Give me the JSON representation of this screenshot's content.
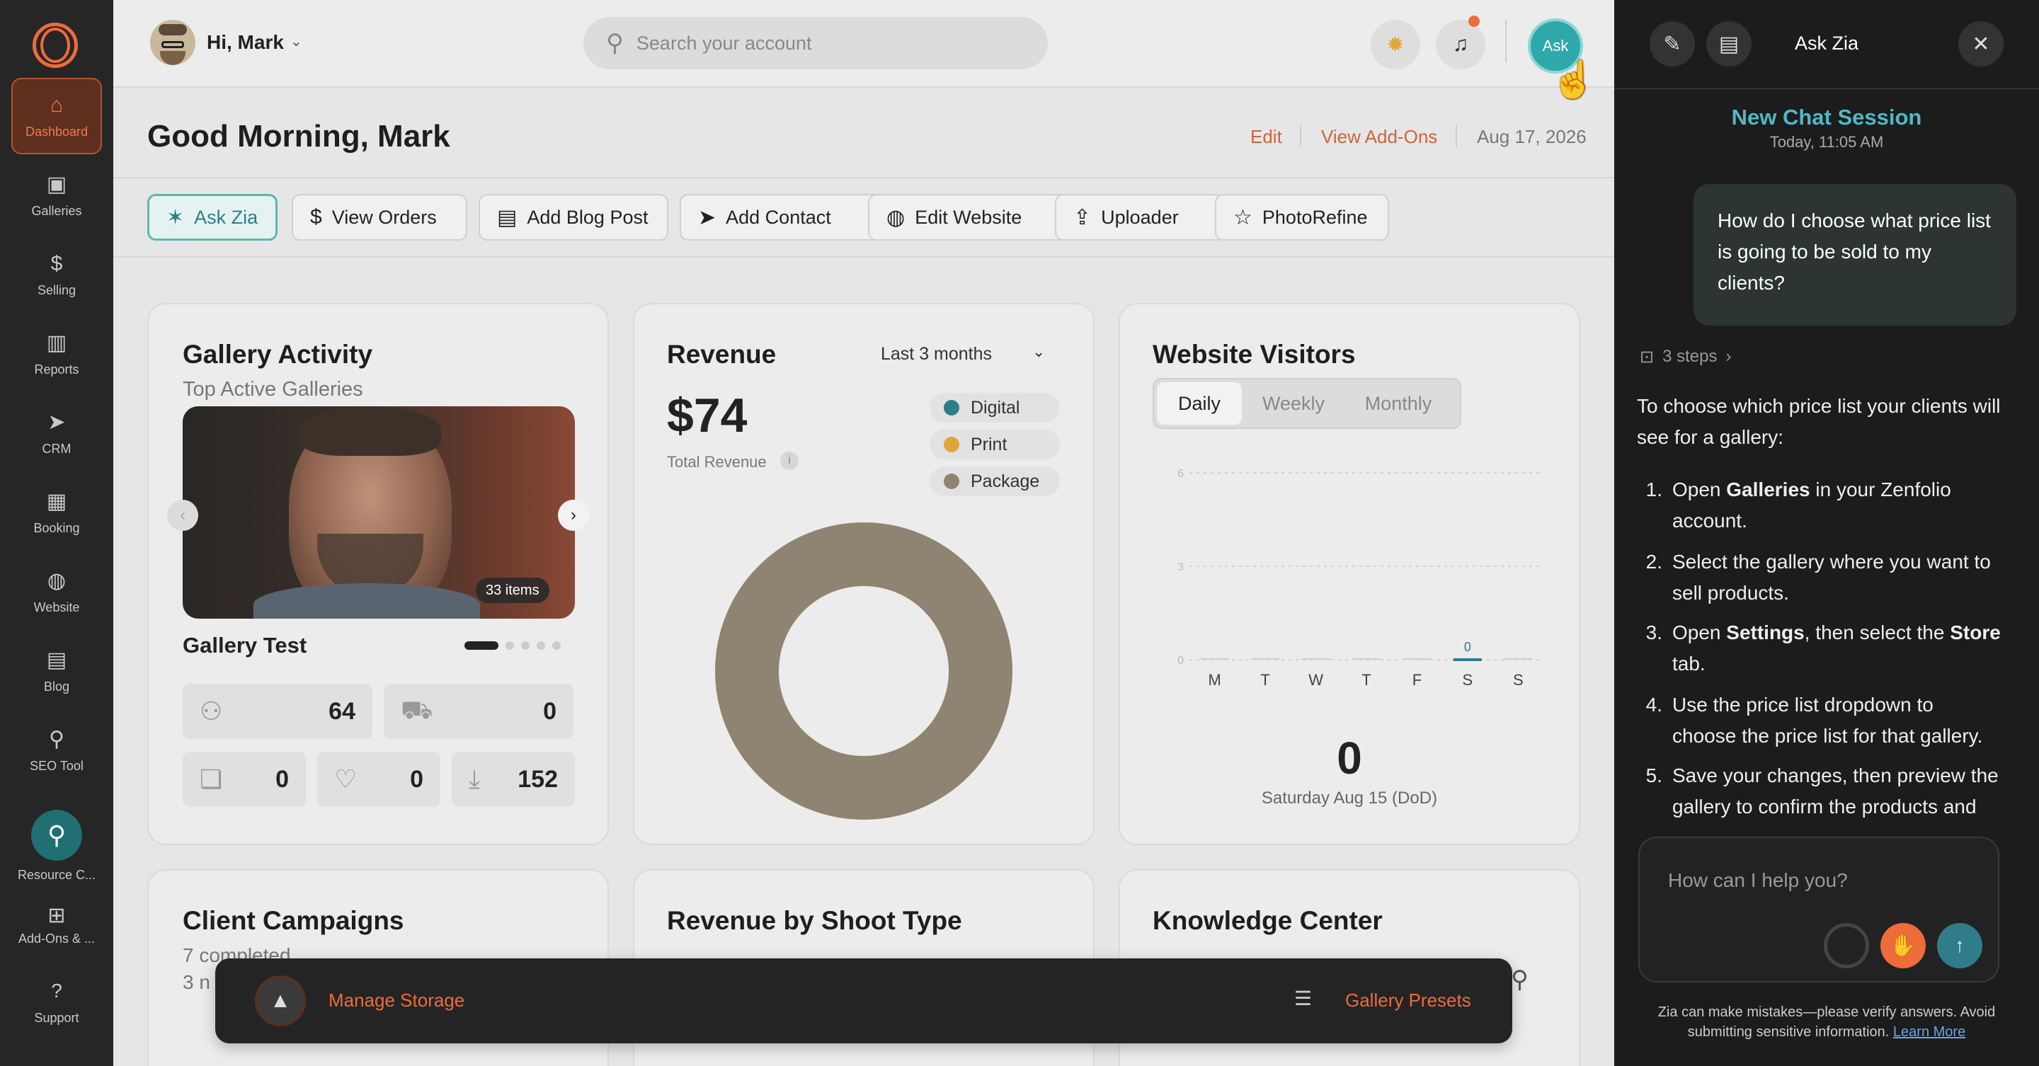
{
  "sidebar": {
    "items": [
      {
        "label": "Dashboard",
        "icon": "home-icon",
        "glyph": "⌂",
        "active": true
      },
      {
        "label": "Galleries",
        "icon": "image-icon",
        "glyph": "▣"
      },
      {
        "label": "Selling",
        "icon": "dollar-icon",
        "glyph": "$"
      },
      {
        "label": "Reports",
        "icon": "bar-chart-icon",
        "glyph": "▥"
      },
      {
        "label": "CRM",
        "icon": "send-icon",
        "glyph": "➤"
      },
      {
        "label": "Booking",
        "icon": "calendar-icon",
        "glyph": "▦"
      },
      {
        "label": "Website",
        "icon": "globe-icon",
        "glyph": "◍"
      },
      {
        "label": "Blog",
        "icon": "document-icon",
        "glyph": "▤"
      },
      {
        "label": "SEO Tool",
        "icon": "seo-icon",
        "glyph": "⚲"
      }
    ],
    "resource": "Resource C...",
    "addons": "Add-Ons & ...",
    "support": "Support"
  },
  "header": {
    "greeting": "Hi, Mark",
    "search_placeholder": "Search your account",
    "ask_badge": "Ask"
  },
  "page": {
    "title": "Good Morning, Mark",
    "edit": "Edit",
    "view_addons": "View Add-Ons",
    "date": "Aug 17, 2026"
  },
  "quick_actions": [
    {
      "label": "Ask Zia",
      "glyph": "✶"
    },
    {
      "label": "View Orders",
      "glyph": "$"
    },
    {
      "label": "Add Blog Post",
      "glyph": "▤"
    },
    {
      "label": "Add Contact",
      "glyph": "➤"
    },
    {
      "label": "Edit Website",
      "glyph": "◍"
    },
    {
      "label": "Uploader",
      "glyph": "⇪"
    },
    {
      "label": "PhotoRefine",
      "glyph": "☆"
    }
  ],
  "gallery": {
    "title": "Gallery Activity",
    "subtitle": "Top Active Galleries",
    "items_badge": "33 items",
    "name": "Gallery Test",
    "stats": {
      "visitors": "64",
      "cart": "0",
      "comments": "0",
      "favorites": "0",
      "downloads": "152"
    }
  },
  "revenue": {
    "title": "Revenue",
    "period": "Last 3 months",
    "total": "$74",
    "total_label": "Total Revenue",
    "legend": [
      {
        "label": "Digital",
        "color": "#2f7d8a"
      },
      {
        "label": "Print",
        "color": "#e0a53a"
      },
      {
        "label": "Package",
        "color": "#8f8471"
      }
    ]
  },
  "visitors": {
    "title": "Website Visitors",
    "tabs": [
      "Daily",
      "Weekly",
      "Monthly"
    ],
    "count": "0",
    "date": "Saturday Aug 15 (DoD)"
  },
  "chart_data": {
    "type": "bar",
    "categories": [
      "M",
      "T",
      "W",
      "T",
      "F",
      "S",
      "S"
    ],
    "values": [
      0,
      0,
      0,
      0,
      0,
      0,
      0
    ],
    "y_ticks": [
      "6",
      "3",
      "0"
    ],
    "ylim": [
      0,
      6
    ],
    "data_labels": [
      {
        "index": 5,
        "text": "0"
      }
    ],
    "highlight_color": "#2f7d8a"
  },
  "bottom_cards": {
    "campaigns": "Client Campaigns",
    "completed": "7 completed",
    "second_line": "3 n",
    "shoot_type": "Revenue by Shoot Type",
    "knowledge": "Knowledge Center"
  },
  "toast": {
    "manage_storage": "Manage Storage",
    "gallery_presets": "Gallery Presets"
  },
  "zia": {
    "title": "Ask Zia",
    "session_title": "New Chat Session",
    "session_time": "Today, 11:05 AM",
    "user_message": "How do I choose what price list is going to be sold to my clients?",
    "steps": "3 steps",
    "intro": "To choose which price list your clients will see for a gallery:",
    "items": [
      {
        "num": "1.",
        "a": "Open ",
        "b": "Galleries",
        "c": " in your Zenfolio account."
      },
      {
        "num": "2.",
        "a": "Select the gallery where you want to sell products.",
        "b": "",
        "c": ""
      },
      {
        "num": "3.",
        "a": "Open ",
        "b": "Settings",
        "c": ", then select the ",
        "d": "Store",
        "e": " tab."
      },
      {
        "num": "4.",
        "a": "Use the price list dropdown to choose the price list for that gallery.",
        "b": "",
        "c": ""
      },
      {
        "num": "5.",
        "a": "Save your changes, then preview the gallery to confirm the products and",
        "b": "",
        "c": ""
      }
    ],
    "input_placeholder": "How can I help you?",
    "disclaimer": "Zia can make mistakes—please verify answers. Avoid submitting sensitive information.",
    "learn_more": "Learn More"
  },
  "colors": {
    "accent": "#ee6b3a",
    "teal": "#2f7d8a",
    "zia_title": "#4fb8c4"
  }
}
